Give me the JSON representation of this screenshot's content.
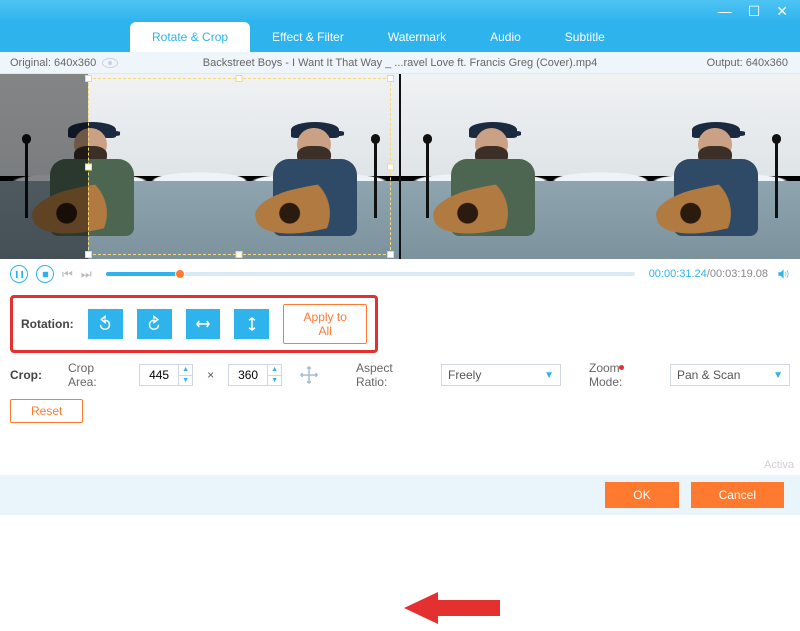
{
  "window": {
    "minimize_glyph": "—",
    "maximize_glyph": "☐",
    "close_glyph": "✕"
  },
  "tabs": {
    "rotate_crop": "Rotate & Crop",
    "effect_filter": "Effect & Filter",
    "watermark": "Watermark",
    "audio": "Audio",
    "subtitle": "Subtitle"
  },
  "info": {
    "original_label": "Original: 640x360",
    "filename": "Backstreet Boys - I Want It That Way _ ...ravel Love ft. Francis Greg (Cover).mp4",
    "output_label": "Output: 640x360"
  },
  "playback": {
    "current": "00:00:31.24",
    "separator": "/",
    "total": "00:03:19.08"
  },
  "rotation": {
    "label": "Rotation:",
    "apply_all": "Apply to All"
  },
  "crop": {
    "label": "Crop:",
    "area_label": "Crop Area:",
    "width": "445",
    "times": "×",
    "height": "360",
    "aspect_label": "Aspect Ratio:",
    "aspect_value": "Freely",
    "zoom_label": "Zoom Mode:",
    "zoom_value": "Pan & Scan",
    "reset": "Reset"
  },
  "footer": {
    "ok": "OK",
    "cancel": "Cancel"
  },
  "misc": {
    "activate_hint": "Activa"
  }
}
